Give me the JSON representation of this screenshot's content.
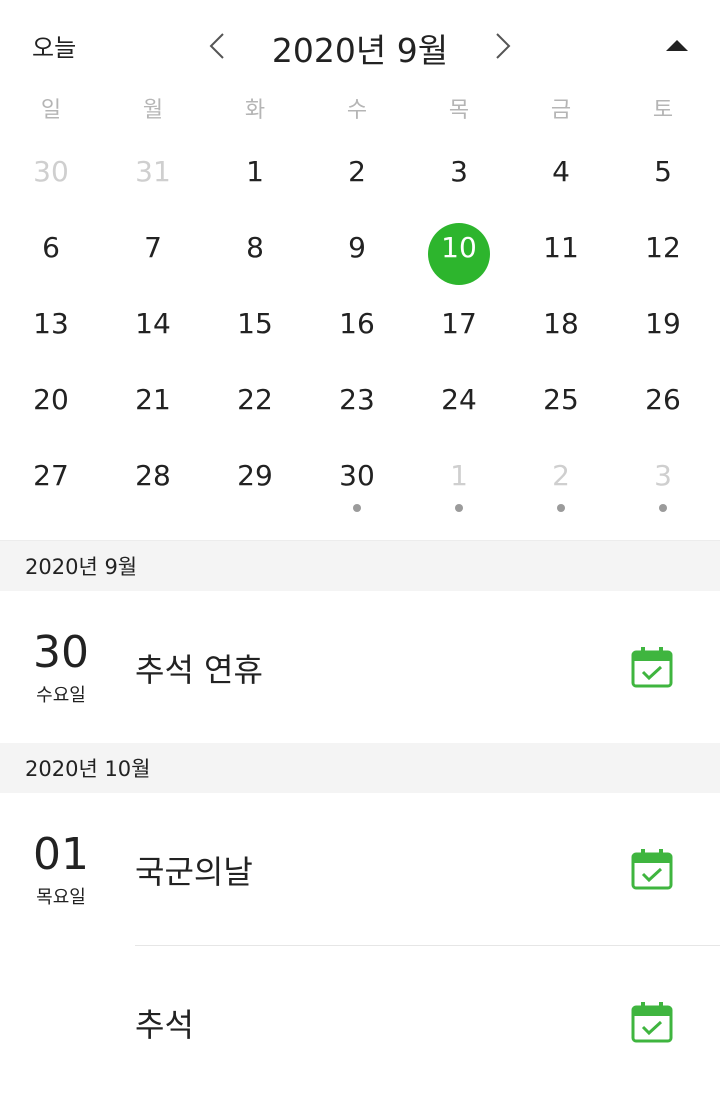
{
  "header": {
    "today_label": "오늘",
    "month_title": "2020년 9월",
    "prev_icon": "chevron-left-icon",
    "next_icon": "chevron-right-icon",
    "collapse_icon": "caret-up-icon"
  },
  "weekdays": [
    "일",
    "월",
    "화",
    "수",
    "목",
    "금",
    "토"
  ],
  "weeks": [
    [
      {
        "n": "30",
        "m": true
      },
      {
        "n": "31",
        "m": true
      },
      {
        "n": "1"
      },
      {
        "n": "2"
      },
      {
        "n": "3"
      },
      {
        "n": "4"
      },
      {
        "n": "5"
      }
    ],
    [
      {
        "n": "6"
      },
      {
        "n": "7"
      },
      {
        "n": "8"
      },
      {
        "n": "9"
      },
      {
        "n": "10",
        "sel": true
      },
      {
        "n": "11"
      },
      {
        "n": "12"
      }
    ],
    [
      {
        "n": "13"
      },
      {
        "n": "14"
      },
      {
        "n": "15"
      },
      {
        "n": "16"
      },
      {
        "n": "17"
      },
      {
        "n": "18"
      },
      {
        "n": "19"
      }
    ],
    [
      {
        "n": "20"
      },
      {
        "n": "21"
      },
      {
        "n": "22"
      },
      {
        "n": "23"
      },
      {
        "n": "24"
      },
      {
        "n": "25"
      },
      {
        "n": "26"
      }
    ],
    [
      {
        "n": "27"
      },
      {
        "n": "28"
      },
      {
        "n": "29"
      },
      {
        "n": "30",
        "dot": true
      },
      {
        "n": "1",
        "m": true,
        "dot": true
      },
      {
        "n": "2",
        "m": true,
        "dot": true
      },
      {
        "n": "3",
        "m": true,
        "dot": true
      }
    ]
  ],
  "agenda": {
    "section1": {
      "header": "2020년 9월",
      "date_num": "30",
      "date_dow": "수요일",
      "event_title": "추석 연휴",
      "event_icon": "calendar-check-icon"
    },
    "section2": {
      "header": "2020년 10월",
      "date_num": "01",
      "date_dow": "목요일",
      "event1_title": "국군의날",
      "event2_title": "추석",
      "event_icon": "calendar-check-icon"
    }
  },
  "colors": {
    "accent": "#2db52d",
    "icon_green": "#3fb53f",
    "muted_text": "#cfcfcf",
    "section_bg": "#f4f4f4"
  }
}
